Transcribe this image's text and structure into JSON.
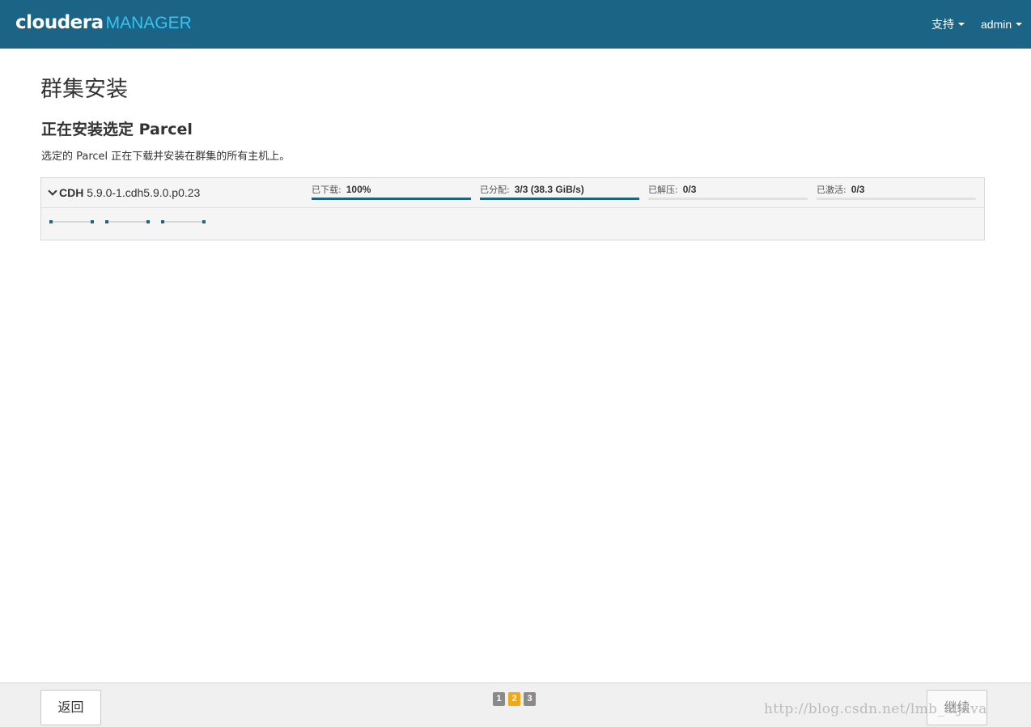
{
  "app": {
    "logo_text": "cloudera",
    "logo_suffix": "MANAGER"
  },
  "nav": {
    "support_label": "支持",
    "user_label": "admin"
  },
  "page": {
    "title": "群集安装",
    "section_title": "正在安装选定 Parcel",
    "description": "选定的 Parcel 正在下载并安装在群集的所有主机上。"
  },
  "parcel": {
    "name": "CDH",
    "version": "5.9.0-1.cdh5.9.0.p0.23",
    "stats": [
      {
        "label": "已下载:",
        "value": "100%",
        "progress": 1.0
      },
      {
        "label": "已分配:",
        "value": "3/3 (38.3 GiB/s)",
        "progress": 1.0
      },
      {
        "label": "已解压:",
        "value": "0/3",
        "progress": 0.0
      },
      {
        "label": "已激活:",
        "value": "0/3",
        "progress": 0.0
      }
    ],
    "host_count": 3
  },
  "footer": {
    "back_label": "返回",
    "continue_label": "继续",
    "steps": [
      "1",
      "2",
      "3"
    ],
    "active_step": 2
  },
  "watermark": "http://blog.csdn.net/lmb_aijava",
  "colors": {
    "navbar": "#1b6486",
    "logo_accent": "#39c2f0",
    "progress": "#1b6486",
    "active_step": "#f1a816"
  },
  "icons": {
    "parcel_toggle": "chevron-down-icon",
    "menu_caret": "caret-down-icon"
  }
}
